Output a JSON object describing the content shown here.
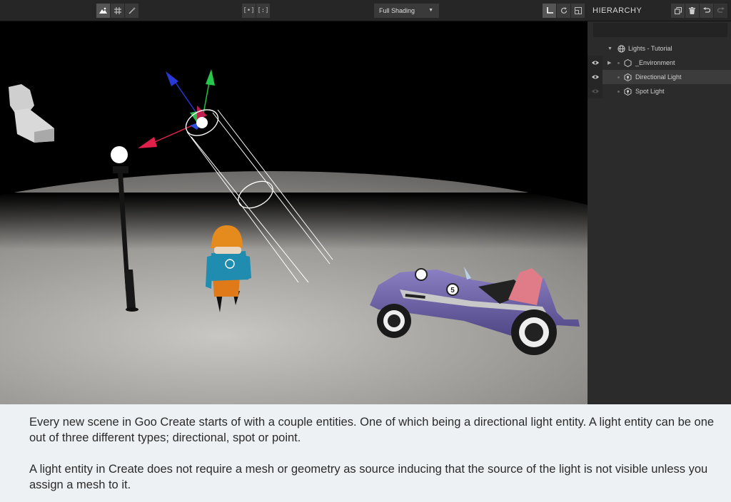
{
  "toolbar": {
    "left_tools": [
      {
        "icon": "landscape-icon",
        "active": true
      },
      {
        "icon": "grid-icon",
        "active": false
      },
      {
        "icon": "magic-wand-icon",
        "active": false
      }
    ],
    "center_tools": [
      {
        "label": "[•]",
        "icon": "frame-selected-icon"
      },
      {
        "label": "[:]",
        "icon": "frame-all-icon"
      }
    ],
    "shading_select": {
      "value": "Full Shading",
      "icon": "caret-down-icon"
    },
    "transform_tools": [
      {
        "icon": "translate-icon",
        "active": true
      },
      {
        "icon": "rotate-icon",
        "active": false
      },
      {
        "icon": "scale-icon",
        "active": false
      }
    ]
  },
  "hierarchy": {
    "title": "HIERARCHY",
    "tools": [
      {
        "icon": "duplicate-icon"
      },
      {
        "icon": "trash-icon"
      },
      {
        "icon": "undo-icon"
      },
      {
        "icon": "redo-icon"
      }
    ],
    "search": {
      "placeholder": "",
      "icon": "search-icon"
    },
    "items": [
      {
        "label": "Lights - Tutorial",
        "icon": "globe-icon",
        "expanded": true,
        "depth": 0,
        "visible": null,
        "selected": false
      },
      {
        "label": "_Environment",
        "icon": "hexagon-icon",
        "expanded": false,
        "depth": 1,
        "visible": true,
        "selected": false
      },
      {
        "label": "Directional Light",
        "icon": "light-entity-icon",
        "expanded": null,
        "depth": 1,
        "visible": true,
        "selected": true
      },
      {
        "label": "Spot Light",
        "icon": "light-entity-icon",
        "expanded": null,
        "depth": 1,
        "visible": false,
        "selected": false
      }
    ]
  },
  "viewport": {
    "scene_objects": [
      "directional-light-gizmo",
      "street-lamp",
      "character",
      "car",
      "armchair"
    ],
    "car_number": "5"
  },
  "caption": {
    "paragraph1": "Every new scene in Goo Create starts of with a couple entities. One of which being a directional light entity. A light entity can be one out of three different types; directional, spot or point.",
    "paragraph2": "A light entity in Create does not require a mesh or geometry as source inducing that the source of the light is not visible unless you assign a mesh to it."
  },
  "colors": {
    "toolbar_bg": "#262626",
    "panel_bg": "#2b2b2b",
    "selection_bg": "#3c3c3c",
    "caption_bg": "#eef1f4"
  }
}
